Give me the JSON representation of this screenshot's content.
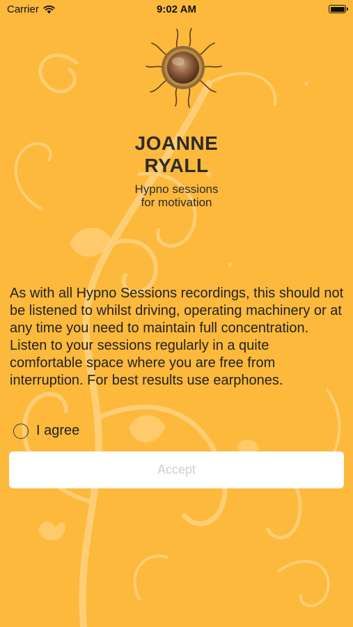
{
  "status_bar": {
    "carrier": "Carrier",
    "time": "9:02 AM",
    "wifi_icon": "wifi-icon",
    "battery_icon": "battery-icon"
  },
  "brand": {
    "name_line1": "JOANNE",
    "name_line2": "RYALL",
    "tagline_line1": "Hypno sessions",
    "tagline_line2": "for motivation",
    "logo_icon": "sun-icon"
  },
  "disclaimer": {
    "text": "As with all Hypno Sessions recordings, this should not be listened to whilst driving, operating machinery or at any time you need to maintain full concentration. Listen to your sessions regularly in a quite comfortable space where you are free from interruption.  For best results use earphones."
  },
  "agreement": {
    "label": "I agree",
    "checked": false
  },
  "accept_button": {
    "label": "Accept",
    "enabled": false
  },
  "colors": {
    "background": "#fcb93c",
    "pattern": "#ffd27a",
    "button_bg": "#ffffff",
    "button_text_disabled": "#cfcfcf"
  }
}
